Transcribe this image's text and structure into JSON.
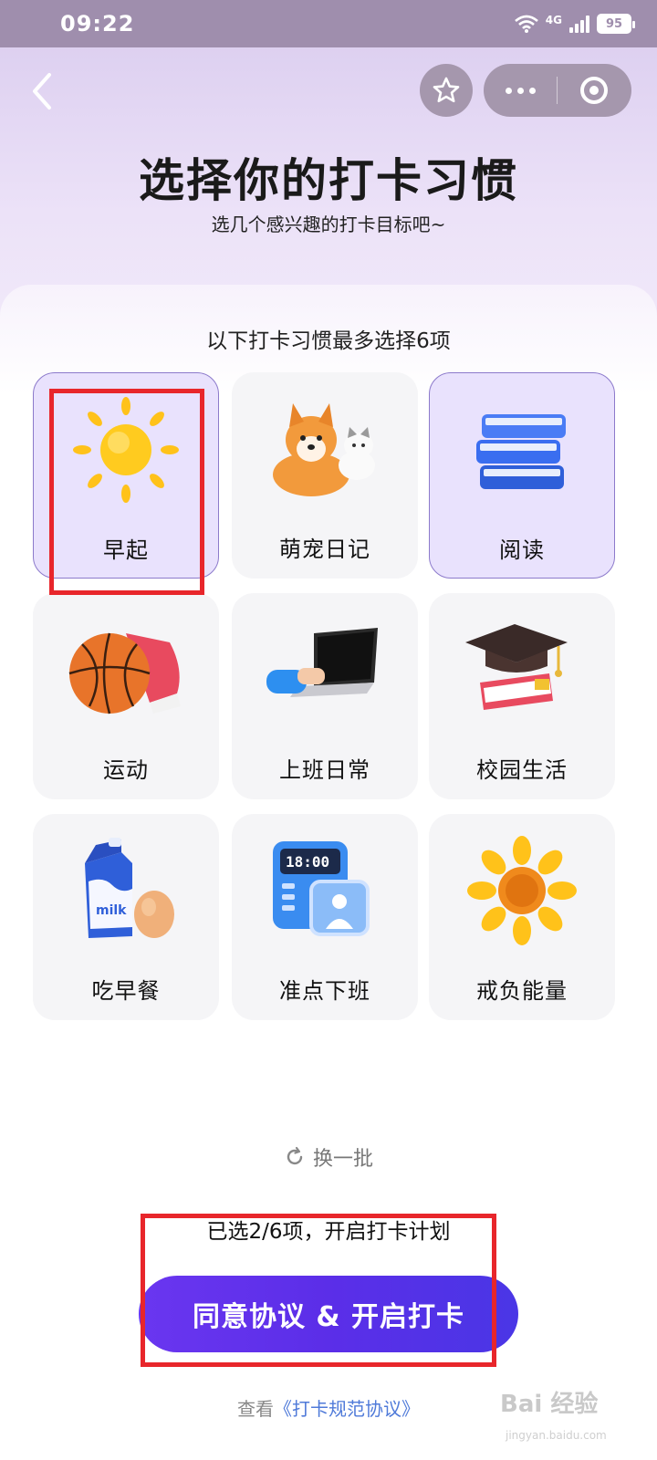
{
  "status_bar": {
    "time": "09:22",
    "network": "4G",
    "battery": "95"
  },
  "nav": {
    "back_icon": "chevron-left-icon",
    "favorite_icon": "star-icon",
    "more_icon": "more-dots-icon",
    "close_icon": "target-icon"
  },
  "header": {
    "title": "选择你的打卡习惯",
    "subtitle": "选几个感兴趣的打卡目标吧~"
  },
  "selection": {
    "limit_text": "以下打卡习惯最多选择6项",
    "habits": [
      {
        "label": "早起",
        "icon": "sun-icon",
        "selected": true
      },
      {
        "label": "萌宠日记",
        "icon": "pets-icon",
        "selected": false
      },
      {
        "label": "阅读",
        "icon": "books-icon",
        "selected": true
      },
      {
        "label": "运动",
        "icon": "basketball-icon",
        "selected": false
      },
      {
        "label": "上班日常",
        "icon": "laptop-icon",
        "selected": false
      },
      {
        "label": "校园生活",
        "icon": "graduation-cap-icon",
        "selected": false
      },
      {
        "label": "吃早餐",
        "icon": "milk-icon",
        "selected": false
      },
      {
        "label": "准点下班",
        "icon": "clock-icon",
        "selected": false
      },
      {
        "label": "戒负能量",
        "icon": "sunflower-icon",
        "selected": false
      }
    ],
    "refresh_label": "换一批",
    "selected_count_text": "已选2/6项，开启打卡计划"
  },
  "cta": {
    "label": "同意协议 & 开启打卡"
  },
  "agreement": {
    "prefix": "查看",
    "link": "《打卡规范协议》"
  },
  "watermark": {
    "text": "Bai 经验",
    "sub": "jingyan.baidu.com"
  },
  "colors": {
    "accent": "#5b2ee8",
    "selected_tile": "#e9e2fd",
    "highlight_box": "#e8262b",
    "link": "#4f7ad9"
  }
}
